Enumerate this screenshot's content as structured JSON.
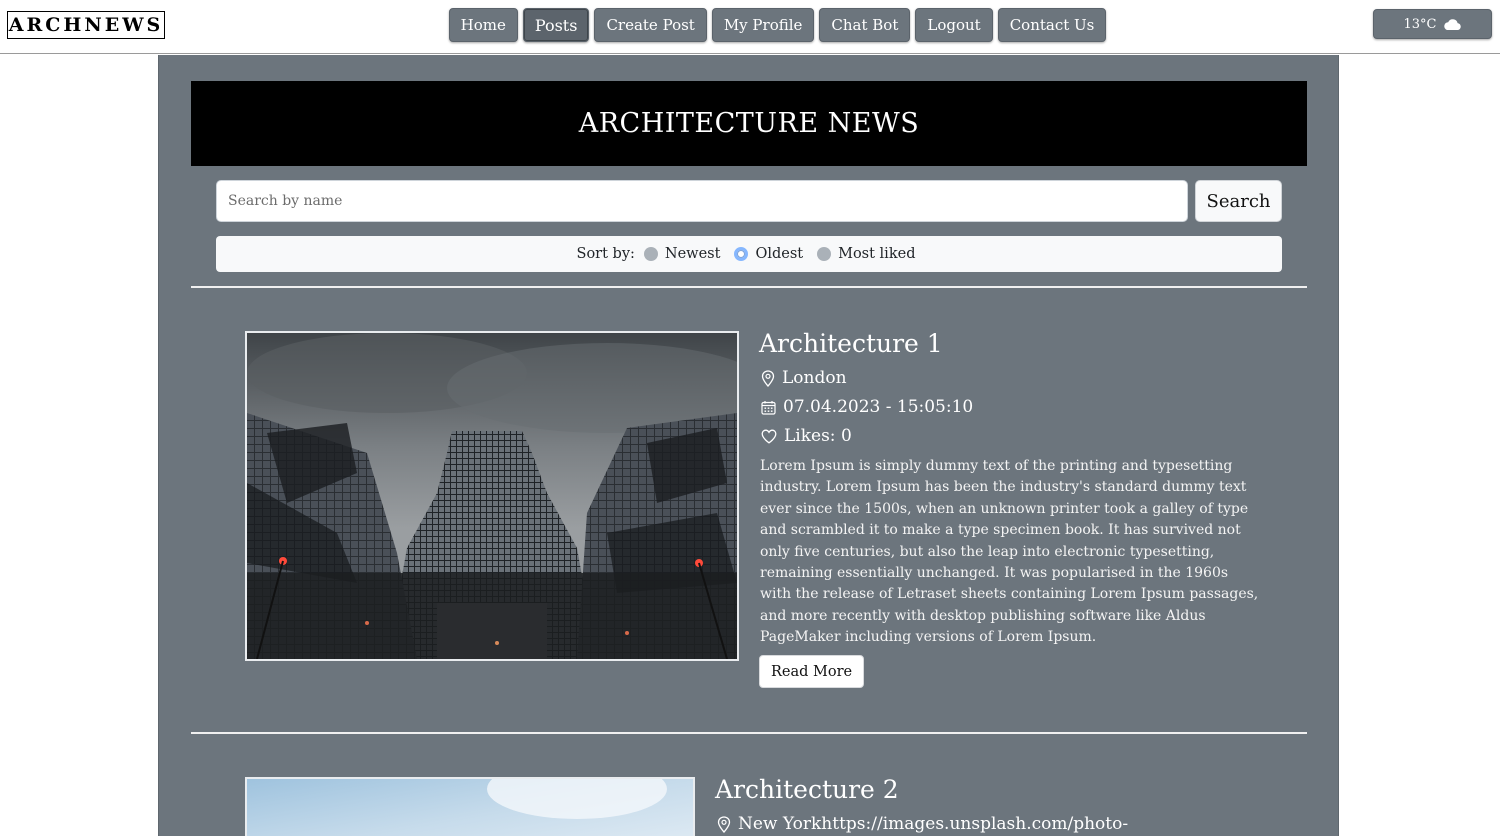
{
  "brand": {
    "logo_text": "ARCHNEWS"
  },
  "nav": {
    "items": [
      {
        "label": "Home"
      },
      {
        "label": "Posts",
        "active": true
      },
      {
        "label": "Create Post"
      },
      {
        "label": "My Profile"
      },
      {
        "label": "Chat Bot"
      },
      {
        "label": "Logout"
      },
      {
        "label": "Contact Us"
      }
    ]
  },
  "weather": {
    "temperature": "13°C",
    "icon": "cloud-icon"
  },
  "main": {
    "banner_title": "ARCHITECTURE NEWS",
    "search": {
      "placeholder": "Search by name",
      "value": "",
      "button_label": "Search"
    },
    "sort": {
      "label": "Sort by:",
      "options": [
        {
          "label": "Newest",
          "checked": false
        },
        {
          "label": "Oldest",
          "checked": true
        },
        {
          "label": "Most liked",
          "checked": false
        }
      ]
    }
  },
  "posts": [
    {
      "title": "Architecture 1",
      "location": "London",
      "datetime": "07.04.2023 - 15:05:10",
      "likes": "Likes: 0",
      "body": "Lorem Ipsum is simply dummy text of the printing and typesetting industry. Lorem Ipsum has been the industry's standard dummy text ever since the 1500s, when an unknown printer took a galley of type and scrambled it to make a type specimen book. It has survived not only five centuries, but also the leap into electronic typesetting, remaining essentially unchanged. It was popularised in the 1960s with the release of Letraset sheets containing Lorem Ipsum passages, and more recently with desktop publishing software like Aldus PageMaker including versions of Lorem Ipsum.",
      "read_more": "Read More",
      "image": "skyscrapers-photo"
    },
    {
      "title": "Architecture 2",
      "location": "New Yorkhttps://images.unsplash.com/photo-",
      "image": "sky-photo"
    }
  ],
  "colors": {
    "panel": "#6c757d",
    "banner": "#000000",
    "accent": "#86b7fe"
  }
}
